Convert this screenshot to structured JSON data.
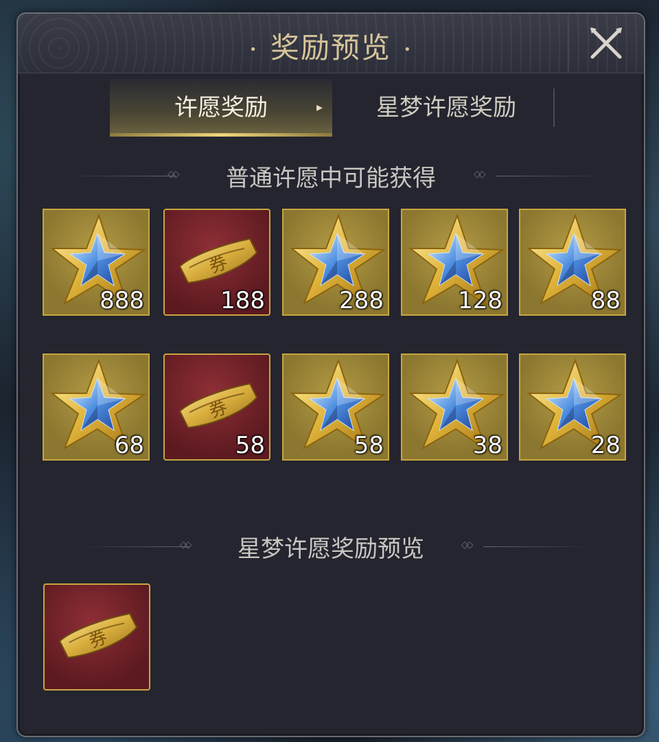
{
  "dialog": {
    "title": "奖励预览",
    "title_dot": "•"
  },
  "tabs": [
    {
      "label": "许愿奖励",
      "active": true
    },
    {
      "label": "星梦许愿奖励",
      "active": false
    }
  ],
  "tab_arrow": "▸",
  "sections": {
    "normal": {
      "title": "普通许愿中可能获得"
    },
    "star_dream": {
      "title": "星梦许愿奖励预览"
    }
  },
  "normal_items": [
    {
      "type": "star",
      "qty": "888"
    },
    {
      "type": "ticket",
      "qty": "188"
    },
    {
      "type": "star",
      "qty": "288"
    },
    {
      "type": "star",
      "qty": "128"
    },
    {
      "type": "star",
      "qty": "88"
    },
    {
      "type": "star",
      "qty": "68"
    },
    {
      "type": "ticket",
      "qty": "58"
    },
    {
      "type": "star",
      "qty": "58"
    },
    {
      "type": "star",
      "qty": "38"
    },
    {
      "type": "star",
      "qty": "28"
    }
  ],
  "star_dream_items": [
    {
      "type": "ticket",
      "qty": ""
    }
  ],
  "ticket_glyph": "券",
  "colors": {
    "gold_text": "#d6c49a",
    "item_border": "#c8a640",
    "panel_bg": "#24252f"
  }
}
